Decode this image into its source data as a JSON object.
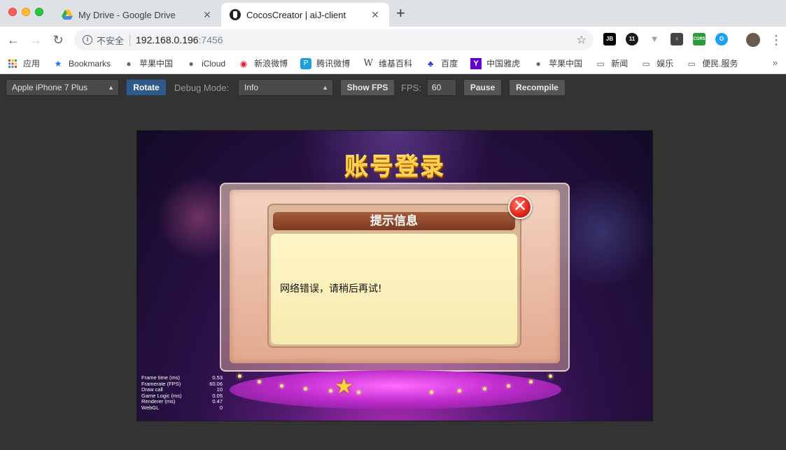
{
  "browser": {
    "tabs": [
      {
        "title": "My Drive - Google Drive",
        "icon": "google-drive-icon",
        "active": false
      },
      {
        "title": "CocosCreator | aiJ-client",
        "icon": "cocos-creator-icon",
        "active": true
      }
    ],
    "new_tab_label": "+",
    "omnibox": {
      "security_label": "不安全",
      "url_host": "192.168.0.196",
      "url_port": ":7456"
    },
    "extensions": [
      {
        "name": "jetbrains-extension-icon",
        "label": "JB",
        "color": "#000000"
      },
      {
        "name": "ublock-extension-icon",
        "label": "11",
        "color": "#1a1a1a"
      },
      {
        "name": "vue-devtools-icon",
        "label": "▼",
        "color": "#9aa0a6"
      },
      {
        "name": "idea-extension-icon",
        "label": "♀",
        "color": "#444444"
      },
      {
        "name": "cors-extension-icon",
        "label": "CORS",
        "color": "#2a9d3a"
      },
      {
        "name": "circle-extension-icon",
        "label": "O",
        "color": "#1da1f2"
      }
    ],
    "bookmarks": [
      {
        "label": "应用",
        "icon": "apps-grid-icon"
      },
      {
        "label": "Bookmarks",
        "icon": "star-icon"
      },
      {
        "label": "苹果中国",
        "icon": "apple-icon"
      },
      {
        "label": "iCloud",
        "icon": "apple-icon"
      },
      {
        "label": "新浪微博",
        "icon": "weibo-icon"
      },
      {
        "label": "腾讯微博",
        "icon": "tencent-weibo-icon"
      },
      {
        "label": "维基百科",
        "icon": "wikipedia-icon"
      },
      {
        "label": "百度",
        "icon": "baidu-icon"
      },
      {
        "label": "中国雅虎",
        "icon": "yahoo-icon"
      },
      {
        "label": "苹果中国",
        "icon": "apple-icon"
      },
      {
        "label": "新闻",
        "icon": "folder-icon"
      },
      {
        "label": "娱乐",
        "icon": "folder-icon"
      },
      {
        "label": "便民.服务",
        "icon": "folder-icon"
      }
    ],
    "bookmarks_more": "»"
  },
  "cocos": {
    "device_select": "Apple iPhone 7 Plus",
    "rotate_label": "Rotate",
    "debug_mode_label": "Debug Mode:",
    "debug_mode_value": "Info",
    "show_fps_label": "Show FPS",
    "fps_label": "FPS:",
    "fps_value": "60",
    "pause_label": "Pause",
    "recompile_label": "Recompile"
  },
  "game": {
    "title": "账号登录",
    "dialog_title": "提示信息",
    "dialog_message": "网络错误，请稍后再试!",
    "close_symbol": "✕",
    "stats": [
      {
        "label": "Frame time (ms)",
        "value": "0.53"
      },
      {
        "label": "Framerate (FPS)",
        "value": "60.06"
      },
      {
        "label": "Draw call",
        "value": "10"
      },
      {
        "label": "Game Logic (ms)",
        "value": "0.05"
      },
      {
        "label": "Renderer (ms)",
        "value": "0.47"
      },
      {
        "label": "WebGL",
        "value": "0"
      }
    ]
  },
  "colors": {
    "accent": "#2f5a88",
    "title_gold": "#ffd24a",
    "dialog_header": "#7c3a22",
    "close_red": "#e42a1a"
  }
}
